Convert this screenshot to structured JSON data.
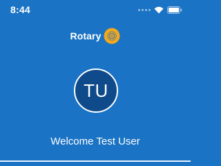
{
  "status_bar": {
    "time": "8:44",
    "icons": [
      "signal-dots-icon",
      "wifi-icon",
      "battery-icon"
    ]
  },
  "header": {
    "logo_text": "Rotary",
    "logo_icon": "rotary-wheel-icon"
  },
  "profile": {
    "initials": "TU",
    "welcome_text": "Welcome Test User"
  },
  "colors": {
    "background": "#1a73c4",
    "avatar_fill": "#0f4a8a",
    "text": "#ffffff",
    "wheel_gold": "#f7a81b"
  }
}
